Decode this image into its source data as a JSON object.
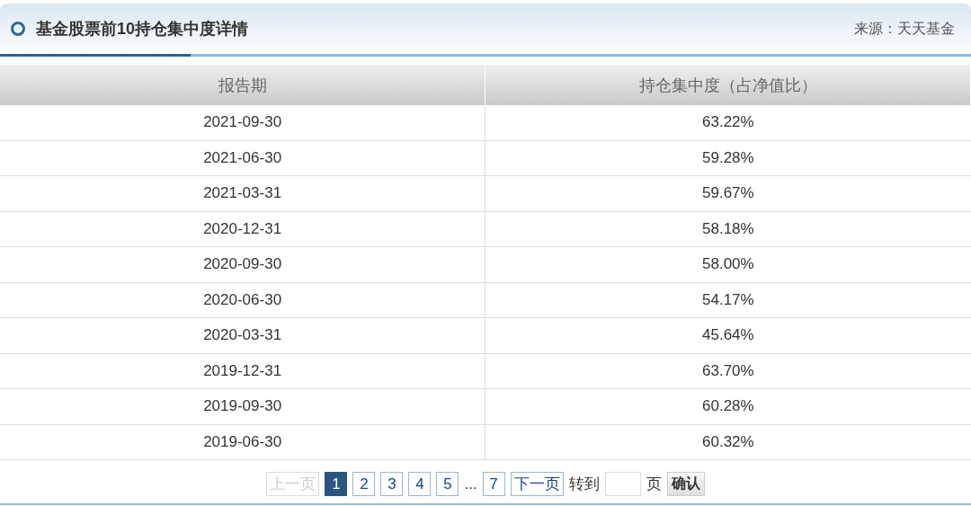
{
  "header": {
    "title": "基金股票前10持仓集中度详情",
    "source": "来源：天天基金"
  },
  "table": {
    "columns": [
      "报告期",
      "持仓集中度（占净值比）"
    ],
    "rows": [
      [
        "2021-09-30",
        "63.22%"
      ],
      [
        "2021-06-30",
        "59.28%"
      ],
      [
        "2021-03-31",
        "59.67%"
      ],
      [
        "2020-12-31",
        "58.18%"
      ],
      [
        "2020-09-30",
        "58.00%"
      ],
      [
        "2020-06-30",
        "54.17%"
      ],
      [
        "2020-03-31",
        "45.64%"
      ],
      [
        "2019-12-31",
        "63.70%"
      ],
      [
        "2019-09-30",
        "60.28%"
      ],
      [
        "2019-06-30",
        "60.32%"
      ]
    ]
  },
  "pagination": [
    {
      "kind": "prev",
      "label": "上一页",
      "disabled": true
    },
    {
      "kind": "page",
      "label": "1",
      "selected": true
    },
    {
      "kind": "page",
      "label": "2",
      "selected": false
    },
    {
      "kind": "page",
      "label": "3",
      "selected": false
    },
    {
      "kind": "page",
      "label": "4",
      "selected": false
    },
    {
      "kind": "page",
      "label": "5",
      "selected": false
    },
    {
      "kind": "ellipsis",
      "label": "..."
    },
    {
      "kind": "page",
      "label": "7",
      "selected": false
    },
    {
      "kind": "next",
      "label": "下一页",
      "disabled": false
    },
    {
      "kind": "text",
      "label": "转到"
    },
    {
      "kind": "input"
    },
    {
      "kind": "text",
      "label": "页"
    },
    {
      "kind": "confirm",
      "label": "确认"
    }
  ]
}
